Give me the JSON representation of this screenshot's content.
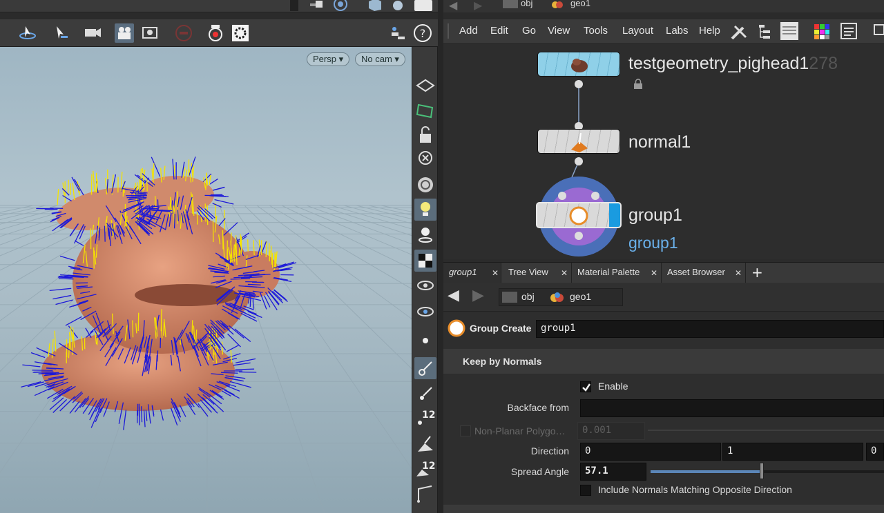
{
  "viewport": {
    "camera_view": "Persp",
    "camera_select": "No cam"
  },
  "network": {
    "breadcrumb": {
      "root": "obj",
      "current": "geo1"
    },
    "menu": [
      "Add",
      "Edit",
      "Go",
      "View",
      "Tools",
      "Layout",
      "Labs",
      "Help"
    ],
    "nodes": {
      "pighead": {
        "name": "testgeometry_pighead1",
        "ghost_suffix": "278"
      },
      "normal": {
        "name": "normal1"
      },
      "group": {
        "name": "group1",
        "sub_label": "group1"
      }
    }
  },
  "tabs": [
    {
      "label": "group1"
    },
    {
      "label": "Tree View"
    },
    {
      "label": "Material Palette"
    },
    {
      "label": "Asset Browser"
    }
  ],
  "params": {
    "breadcrumb": {
      "root": "obj",
      "current": "geo1"
    },
    "node_type": "Group Create",
    "node_name": "group1",
    "section_title": "Keep by Normals",
    "enable_label": "Enable",
    "backface_label": "Backface from",
    "nonplanar_label": "Non-Planar Polygo…",
    "nonplanar_value": "0.001",
    "direction_label": "Direction",
    "direction_values": [
      "0",
      "1",
      "0"
    ],
    "spread_label": "Spread Angle",
    "spread_value": "57.1",
    "opposite_label": "Include Normals Matching Opposite Direction"
  },
  "shelf": {
    "badge_a": "12",
    "badge_b": "12"
  },
  "colors": {
    "pighead_node": "#8fd0e8",
    "group_accent": "#1a9be0",
    "group_ring": "#4a6fb8",
    "normals_blue": "#1c18d8",
    "normals_yellow": "#f5e300",
    "mesh": "#d8896a"
  }
}
